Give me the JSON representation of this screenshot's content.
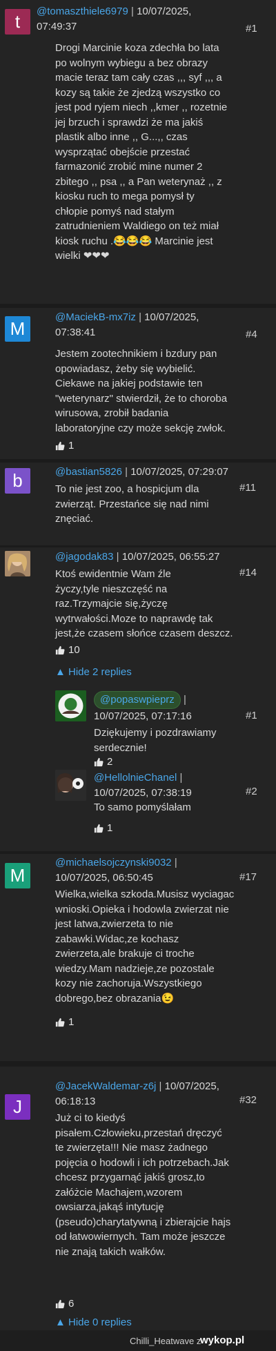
{
  "comments": [
    {
      "avatar_letter": "t",
      "avatar_color": "#9c2a54",
      "username": "@tomaszthiele6979",
      "date_part1": "10/07/2025,",
      "date_part2": "07:49:37",
      "number": "#1",
      "lines": [
        "Drogi Marcinie koza zdechła bo lata",
        "po wolnym wybiegu a bez obrazy",
        "macie teraz tam cały czas ,,, syf ,,, a",
        "kozy są takie że zjedzą wszystko co",
        "jest pod ryjem niech ,,kmer ,, rozetnie",
        "jej brzuch i sprawdzi że ma jakiś",
        "plastik albo inne ,, G...,, czas",
        "wysprzątać obejście przestać",
        "farmazonić zrobić mine numer 2",
        "zbitego ,, psa ,, a Pan weterynaż ,, z",
        "kiosku ruch to mega pomysł ty",
        "chłopie pomyś nad stałym",
        "zatrudnieniem Waldiego on też miał",
        "kiosk ruchu .😂😂😂 Marcinie jest",
        "wielki ❤❤❤"
      ]
    },
    {
      "avatar_letter": "M",
      "avatar_color": "#1e88d6",
      "username": "@MaciekB-mx7iz",
      "date_part1": "10/07/2025,",
      "date_part2": "07:38:41",
      "number": "#4",
      "lines": [
        "Jestem zootechnikiem i bzdury pan",
        "opowiadasz, żeby się wybielić.",
        "Ciekawe na jakiej podstawie ten",
        "\"weterynarz\" stwierdził, że to choroba",
        "wirusowa, zrobił badania",
        "laboratoryjne czy może sekcję zwłok."
      ],
      "likes": "1"
    },
    {
      "avatar_letter": "b",
      "avatar_color": "#7b52c9",
      "username": "@bastian5826",
      "date_full": "10/07/2025, 07:29:07",
      "number": "#11",
      "lines": [
        "To nie jest zoo, a hospicjum dla",
        "zwierząt. Przestańce się nad nimi",
        "znęciać."
      ]
    },
    {
      "username": "@jagodak83",
      "date_full": "10/07/2025, 06:55:27",
      "number": "#14",
      "lines": [
        "Ktoś ewidentnie Wam źle",
        "życzy,tyle nieszczęść na",
        "raz.Trzymajcie się,życzę",
        "wytrwałości.Moze to naprawdę tak",
        "jest,że czasem słońce czasem deszcz."
      ],
      "likes": "10",
      "toggle": "▲ Hide 2 replies",
      "replies": [
        {
          "username": "@popaswpieprz",
          "date": "10/07/2025, 07:17:16",
          "number": "#1",
          "lines": [
            "Dziękujemy i pozdrawiamy",
            "serdecznie!"
          ],
          "likes": "2"
        },
        {
          "username": "@HellolnieChanel",
          "date": "10/07/2025, 07:38:19",
          "number": "#2",
          "lines": [
            "To samo pomyślałam"
          ],
          "likes": "1"
        }
      ]
    },
    {
      "avatar_letter": "M",
      "avatar_color": "#1aa07a",
      "username": "@michaelsojczynski9032",
      "date_full": "10/07/2025, 06:50:45",
      "number": "#17",
      "lines": [
        "Wielka,wielka szkoda.Musisz wyciagac",
        "wnioski.Opieka i hodowla zwierzat nie",
        "jest latwa,zwierzeta to nie",
        "zabawki.Widac,ze kochasz",
        "zwierzeta,ale brakuje ci troche",
        "wiedzy.Mam nadzieje,ze pozostale",
        "kozy nie zachoruja.Wszystkiego",
        "dobrego,bez obrazania😉"
      ],
      "likes": "1"
    },
    {
      "avatar_letter": "J",
      "avatar_color": "#7b2fbf",
      "username": "@JacekWaldemar-z6j",
      "date_part1": "10/07/2025,",
      "date_part2": "06:18:13",
      "number": "#32",
      "lines": [
        "Już ci to kiedyś",
        "pisałem.Człowieku,przestań dręczyć",
        "te zwierzęta!!! Nie masz żadnego",
        "pojęcia o hodowli i ich potrzebach.Jak",
        "chcesz przygarnąć jakiś grosz,to",
        "załóżcie Machajem,wzorem",
        "owsiarza,jakąś intytucję",
        "(pseudo)charytatywną i zbierajcie hajs",
        "od łatwowiernych. Tam może jeszcze",
        "nie znają takich wałków."
      ],
      "likes": "6",
      "toggle": "▲ Hide 0 replies"
    }
  ],
  "footer": {
    "brand": "Chilli_Heatwave z",
    "logo": "wykop.pl"
  }
}
